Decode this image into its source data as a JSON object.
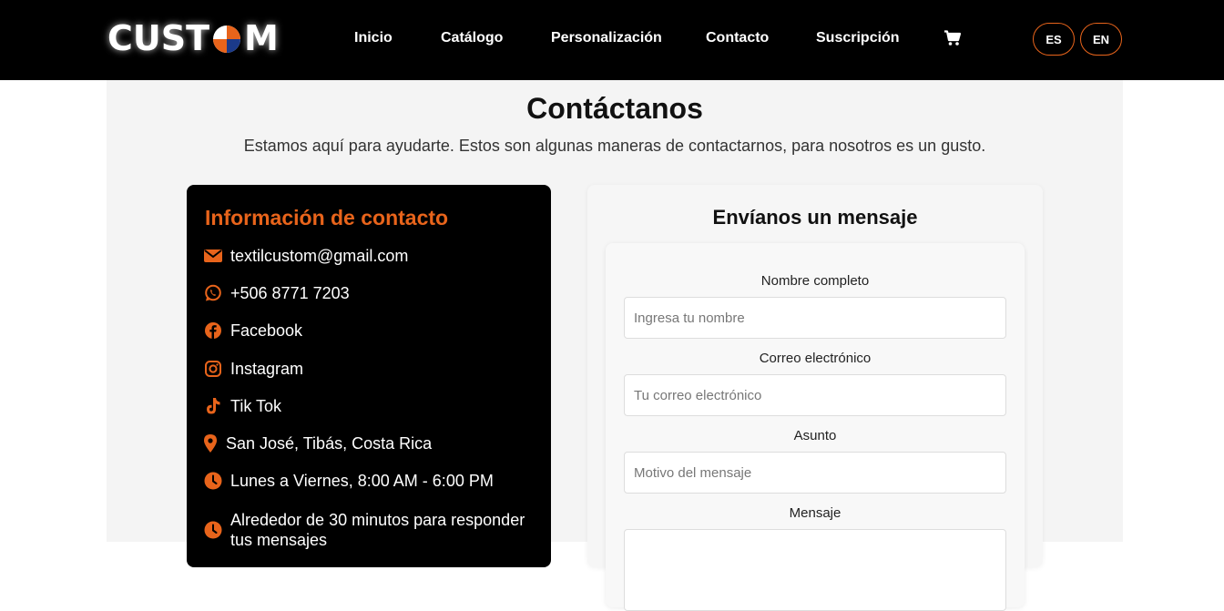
{
  "brand": {
    "logo_left": "CUST",
    "logo_right": "M",
    "accent_color": "#e8641b"
  },
  "nav": {
    "links": [
      "Inicio",
      "Catálogo",
      "Personalización",
      "Contacto",
      "Suscripción"
    ],
    "cart_icon": "cart-icon",
    "languages": [
      "ES",
      "EN"
    ]
  },
  "header": {
    "title": "Contáctanos",
    "subtitle": "Estamos aquí para ayudarte. Estos son algunas maneras de contactarnos, para nosotros es un gusto."
  },
  "contact_info": {
    "title": "Información de contacto",
    "items": [
      {
        "icon": "envelope-icon",
        "text": "textilcustom@gmail.com"
      },
      {
        "icon": "whatsapp-icon",
        "text": "+506 8771 7203"
      },
      {
        "icon": "facebook-icon",
        "text": "Facebook"
      },
      {
        "icon": "instagram-icon",
        "text": "Instagram"
      },
      {
        "icon": "tiktok-icon",
        "text": "Tik Tok"
      },
      {
        "icon": "location-pin-icon",
        "text": "San José, Tibás, Costa Rica"
      },
      {
        "icon": "clock-icon",
        "text": "Lunes a Viernes, 8:00 AM - 6:00 PM"
      },
      {
        "icon": "clock-icon",
        "text": "Alrededor de 30 minutos para responder tus mensajes"
      }
    ]
  },
  "form": {
    "title": "Envíanos un mensaje",
    "fields": [
      {
        "label": "Nombre completo",
        "placeholder": "Ingresa tu nombre",
        "value": ""
      },
      {
        "label": "Correo electrónico",
        "placeholder": "Tu correo electrónico",
        "value": ""
      },
      {
        "label": "Asunto",
        "placeholder": "Motivo del mensaje",
        "value": ""
      },
      {
        "label": "Mensaje",
        "placeholder": "",
        "value": ""
      }
    ]
  }
}
